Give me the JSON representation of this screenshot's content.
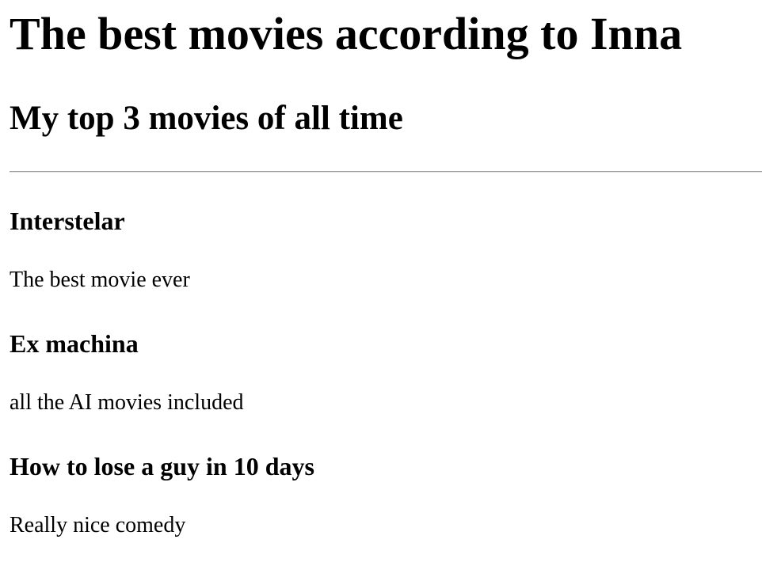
{
  "page": {
    "title": "The best movies according to Inna",
    "subtitle": "My top 3 movies of all time"
  },
  "movies": [
    {
      "title": "Interstelar",
      "description": "The best movie ever"
    },
    {
      "title": "Ex machina",
      "description": "all the AI movies included"
    },
    {
      "title": "How to lose a guy in 10 days",
      "description": "Really nice comedy"
    }
  ]
}
